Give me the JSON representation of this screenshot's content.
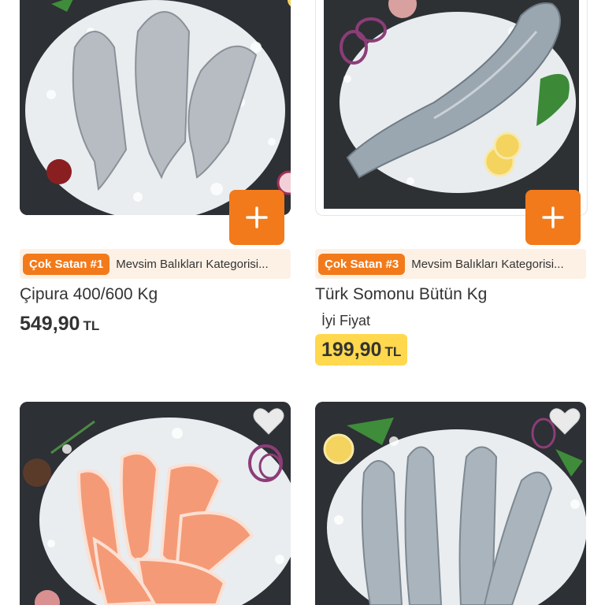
{
  "products": [
    {
      "name": "Çipura 400/600 Kg",
      "badge": "Çok Satan #1",
      "badge_info": "Mevsim Balıkları Kategorisi...",
      "price": "549,90",
      "currency": "TL"
    },
    {
      "name": "Türk Somonu Bütün Kg",
      "badge": "Çok Satan #3",
      "badge_info": "Mevsim Balıkları Kategorisi...",
      "deal_label": "İyi Fiyat",
      "price": "199,90",
      "currency": "TL"
    }
  ],
  "colors": {
    "accent": "#f27a1a",
    "badge_bg": "#fdf1e6",
    "deal_bg": "#ffd84d"
  },
  "icons": [
    "plus-icon",
    "heart-icon"
  ]
}
